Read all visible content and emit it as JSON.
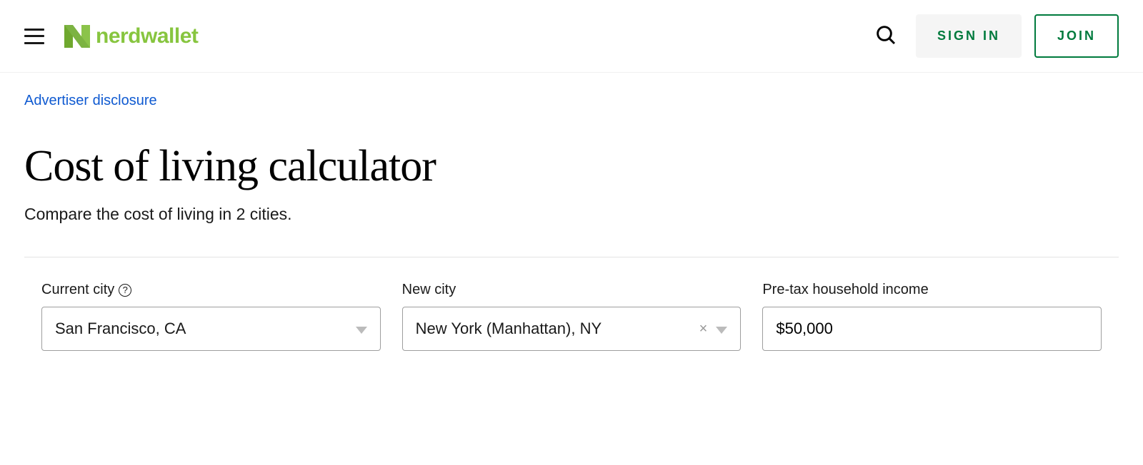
{
  "header": {
    "brand_name": "nerdwallet",
    "sign_in_label": "SIGN IN",
    "join_label": "JOIN"
  },
  "page": {
    "disclosure_label": "Advertiser disclosure",
    "title": "Cost of living calculator",
    "subtitle": "Compare the cost of living in 2 cities."
  },
  "form": {
    "current_city": {
      "label": "Current city",
      "value": "San Francisco, CA"
    },
    "new_city": {
      "label": "New city",
      "value": "New York (Manhattan), NY"
    },
    "income": {
      "label": "Pre-tax household income",
      "value": "$50,000"
    }
  }
}
